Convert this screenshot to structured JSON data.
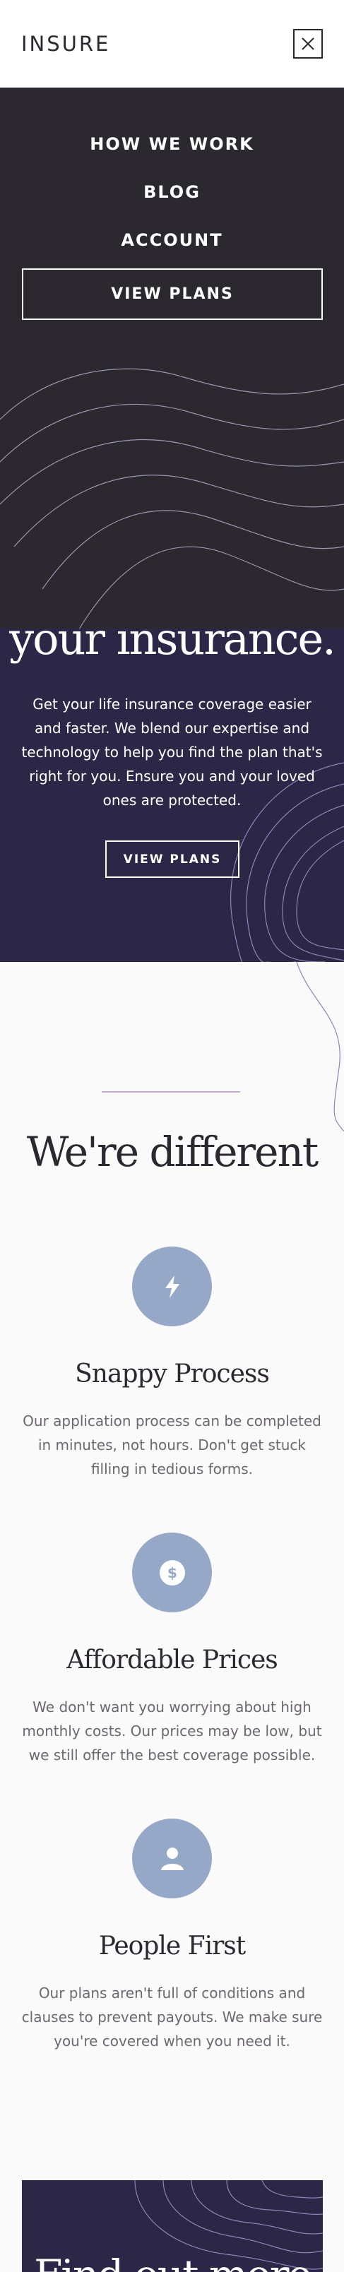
{
  "header": {
    "logo": "INSURE",
    "close_icon": "close-icon"
  },
  "nav": {
    "items": [
      {
        "label": "HOW WE WORK"
      },
      {
        "label": "BLOG"
      },
      {
        "label": "ACCOUNT"
      }
    ],
    "cta_label": "VIEW PLANS"
  },
  "hero": {
    "title": "your insurance.",
    "text": "Get your life insurance coverage easier and faster. We blend our expertise and technology to help you find the plan that's right for you. Ensure you and your loved ones are protected.",
    "button_label": "VIEW PLANS"
  },
  "different": {
    "title": "We're different",
    "features": [
      {
        "icon": "lightning-icon",
        "title": "Snappy Process",
        "text": "Our application process can be completed in minutes, not hours. Don't get stuck filling in tedious forms."
      },
      {
        "icon": "dollar-icon",
        "title": "Affordable Prices",
        "text": "We don't want you worrying about high monthly costs. Our prices may be low, but we still offer the best coverage possible."
      },
      {
        "icon": "person-icon",
        "title": "People First",
        "text": "Our plans aren't full of conditions and clauses to prevent payouts. We make sure you're covered when you need it."
      }
    ]
  },
  "cta": {
    "title": "Find out more"
  },
  "colors": {
    "dark": "#2c2830",
    "navy": "#2c2747",
    "icon_circle": "#96a8c8",
    "accent_line": "#c7a8d2"
  }
}
